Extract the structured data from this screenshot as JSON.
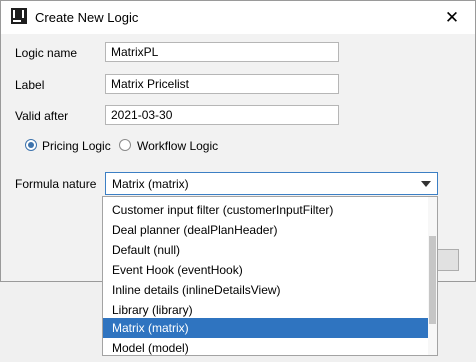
{
  "window": {
    "title": "Create New Logic",
    "close_glyph": "✕",
    "icon": "intellij-idea-icon"
  },
  "form": {
    "logic_name": {
      "label": "Logic name",
      "value": "MatrixPL"
    },
    "label_field": {
      "label": "Label",
      "value": "Matrix Pricelist"
    },
    "valid_after": {
      "label": "Valid after",
      "value": "2021-03-30"
    },
    "logic_type": {
      "options": [
        {
          "label": "Pricing Logic",
          "checked": true
        },
        {
          "label": "Workflow Logic",
          "checked": false
        }
      ]
    },
    "formula_nature": {
      "label": "Formula nature",
      "value": "Matrix (matrix)"
    }
  },
  "dropdown": {
    "items": [
      "Customer input filter (customerInputFilter)",
      "Deal planner (dealPlanHeader)",
      "Default (null)",
      "Event Hook (eventHook)",
      "Inline details (inlineDetailsView)",
      "Library (library)",
      "Matrix (matrix)",
      "Model (model)"
    ],
    "selected_index": 6
  },
  "colors": {
    "selection": "#2f74c0",
    "focus_border": "#3c7fc4",
    "radio_accent": "#3d73ad"
  }
}
